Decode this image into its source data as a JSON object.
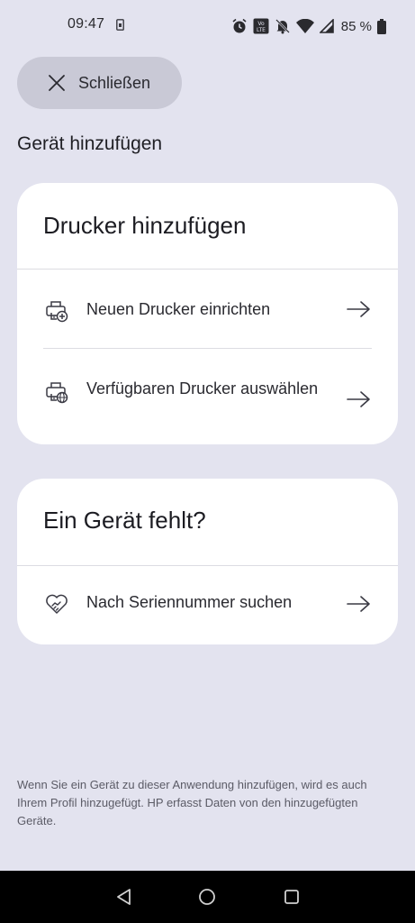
{
  "status_bar": {
    "time": "09:47",
    "battery_text": "85 %",
    "icons": [
      "sim-card-icon",
      "alarm-icon",
      "volte-icon",
      "mute-icon",
      "wifi-icon",
      "signal-icon",
      "battery-icon"
    ]
  },
  "header": {
    "close_label": "Schließen",
    "page_title": "Gerät hinzufügen"
  },
  "printers_card": {
    "title": "Drucker hinzufügen",
    "items": [
      {
        "label": "Neuen Drucker einrichten",
        "icon": "printer-add-icon"
      },
      {
        "label": "Verfügbaren Drucker auswählen",
        "icon": "printer-network-icon"
      }
    ]
  },
  "missing_card": {
    "title": "Ein Gerät fehlt?",
    "items": [
      {
        "label": "Nach Seriennummer suchen",
        "icon": "handshake-heart-icon"
      }
    ]
  },
  "footer": {
    "note": "Wenn Sie ein Gerät zu dieser Anwendung hinzufügen, wird es auch Ihrem Profil hinzugefügt. HP erfasst Daten von den hinzugefügten Geräte."
  },
  "nav_bar": {
    "buttons": [
      "back-icon",
      "home-icon",
      "recents-icon"
    ]
  },
  "colors": {
    "background": "#e3e3ef",
    "card": "#ffffff",
    "close_pill": "#c9c9d6",
    "nav_bar": "#000000"
  }
}
